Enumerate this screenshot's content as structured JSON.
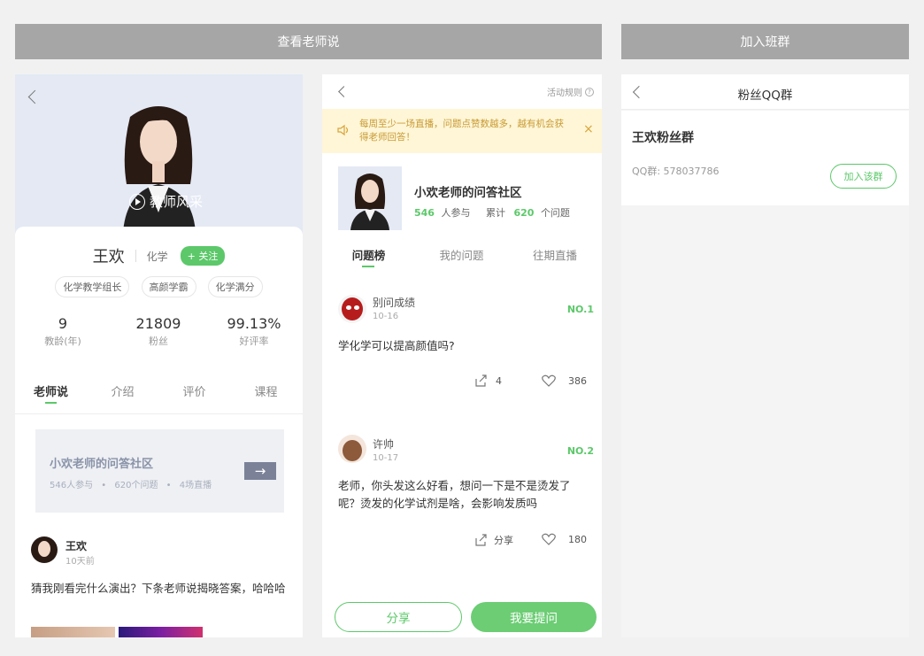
{
  "banners": {
    "left": "查看老师说",
    "right": "加入班群"
  },
  "profile": {
    "video_label": "教师风采",
    "name": "王欢",
    "subject": "化学",
    "follow_label": "+ 关注",
    "tags": [
      "化学教学组长",
      "高颜学霸",
      "化学满分"
    ],
    "stats": [
      {
        "value": "9",
        "label": "教龄(年)"
      },
      {
        "value": "21809",
        "label": "粉丝"
      },
      {
        "value": "99.13%",
        "label": "好评率"
      }
    ],
    "tabs": [
      "老师说",
      "介绍",
      "评价",
      "课程"
    ],
    "community": {
      "title": "小欢老师的问答社区",
      "meta1": "546人参与",
      "meta2": "620个问题",
      "meta3": "4场直播"
    },
    "post": {
      "author": "王欢",
      "time": "10天前",
      "text": "猜我刚看完什么演出？下条老师说揭晓答案，哈哈哈"
    }
  },
  "qa": {
    "rules_label": "活动规则",
    "notice": "每周至少一场直播，问题点赞数越多，越有机会获得老师回答！",
    "community_title": "小欢老师的问答社区",
    "participants": "546",
    "participants_label": "人参与",
    "total_label": "累计",
    "questions": "620",
    "questions_label": "个问题",
    "tabs": [
      "问题榜",
      "我的问题",
      "往期直播"
    ],
    "items": [
      {
        "user": "别问成绩",
        "date": "10-16",
        "rank": "NO.1",
        "text": "学化学可以提高颜值吗?",
        "share": "4",
        "likes": "386"
      },
      {
        "user": "许帅",
        "date": "10-17",
        "rank": "NO.2",
        "text": "老师，你头发这么好看，想问一下是不是烫发了呢？烫发的化学试剂是啥，会影响发质吗",
        "share": "分享",
        "likes": "180"
      }
    ],
    "share_button": "分享",
    "ask_button": "我要提问"
  },
  "group": {
    "title": "粉丝QQ群",
    "name": "王欢粉丝群",
    "qq": "QQ群: 578037786",
    "join_label": "加入该群"
  }
}
